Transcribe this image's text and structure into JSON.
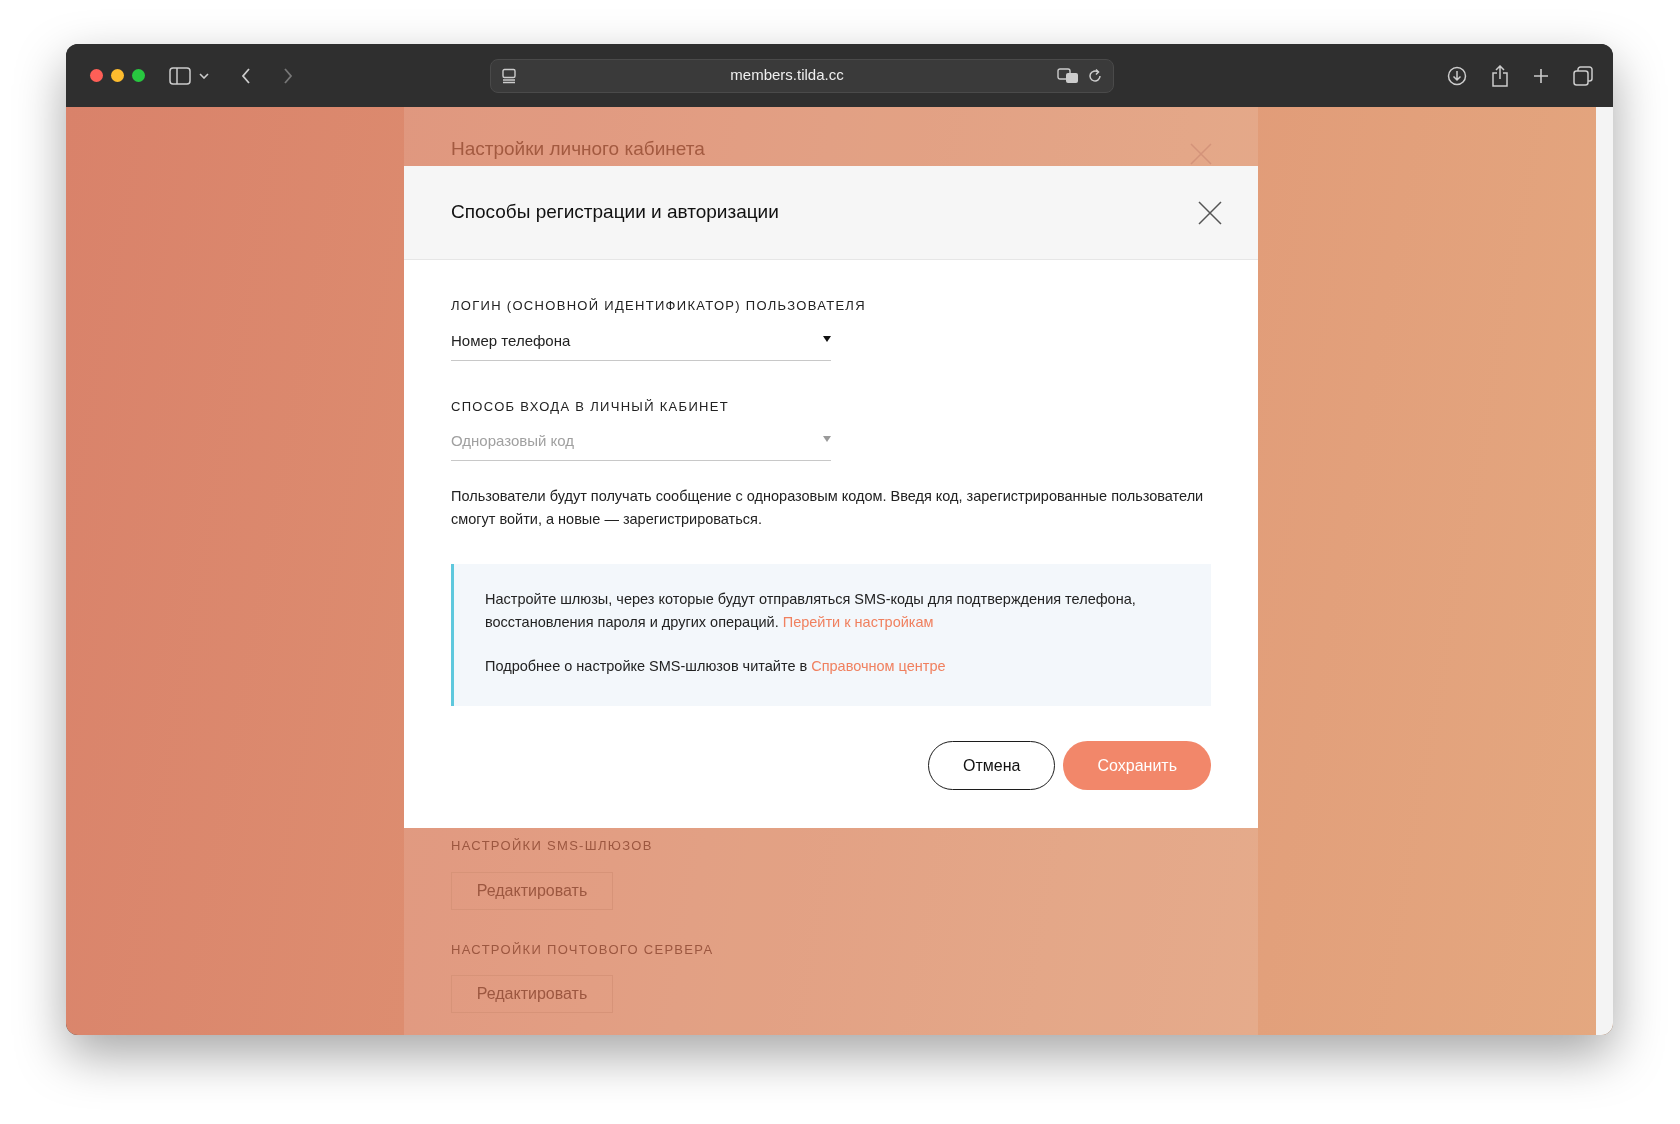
{
  "browser": {
    "url": "members.tilda.cc"
  },
  "background_page": {
    "title": "Настройки личного кабинета",
    "sections": [
      {
        "heading": "НАСТРОЙКИ SMS-ШЛЮЗОВ",
        "button": "Редактировать"
      },
      {
        "heading": "НАСТРОЙКИ ПОЧТОВОГО СЕРВЕРА",
        "button": "Редактировать"
      }
    ]
  },
  "modal": {
    "title": "Способы регистрации и авторизации",
    "fields": [
      {
        "label": "ЛОГИН (ОСНОВНОЙ ИДЕНТИФИКАТОР) ПОЛЬЗОВАТЕЛЯ",
        "value": "Номер телефона",
        "disabled": false
      },
      {
        "label": "СПОСОБ ВХОДА В ЛИЧНЫЙ КАБИНЕТ",
        "value": "Одноразовый код",
        "disabled": true
      }
    ],
    "description": "Пользователи будут получать сообщение с одноразовым кодом. Введя код, зарегистрированные пользователи смогут войти, а новые — зарегистрироваться.",
    "info": [
      {
        "text": "Настройте шлюзы, через которые будут отправляться SMS-коды для подтверждения телефона, восстановления пароля и других операций.",
        "link": "Перейти к настройкам"
      },
      {
        "text": "Подробнее о настройке SMS-шлюзов читайте в",
        "link": "Справочном центре"
      }
    ],
    "buttons": [
      {
        "label": "Отмена",
        "kind": "secondary"
      },
      {
        "label": "Сохранить",
        "kind": "primary"
      }
    ]
  }
}
